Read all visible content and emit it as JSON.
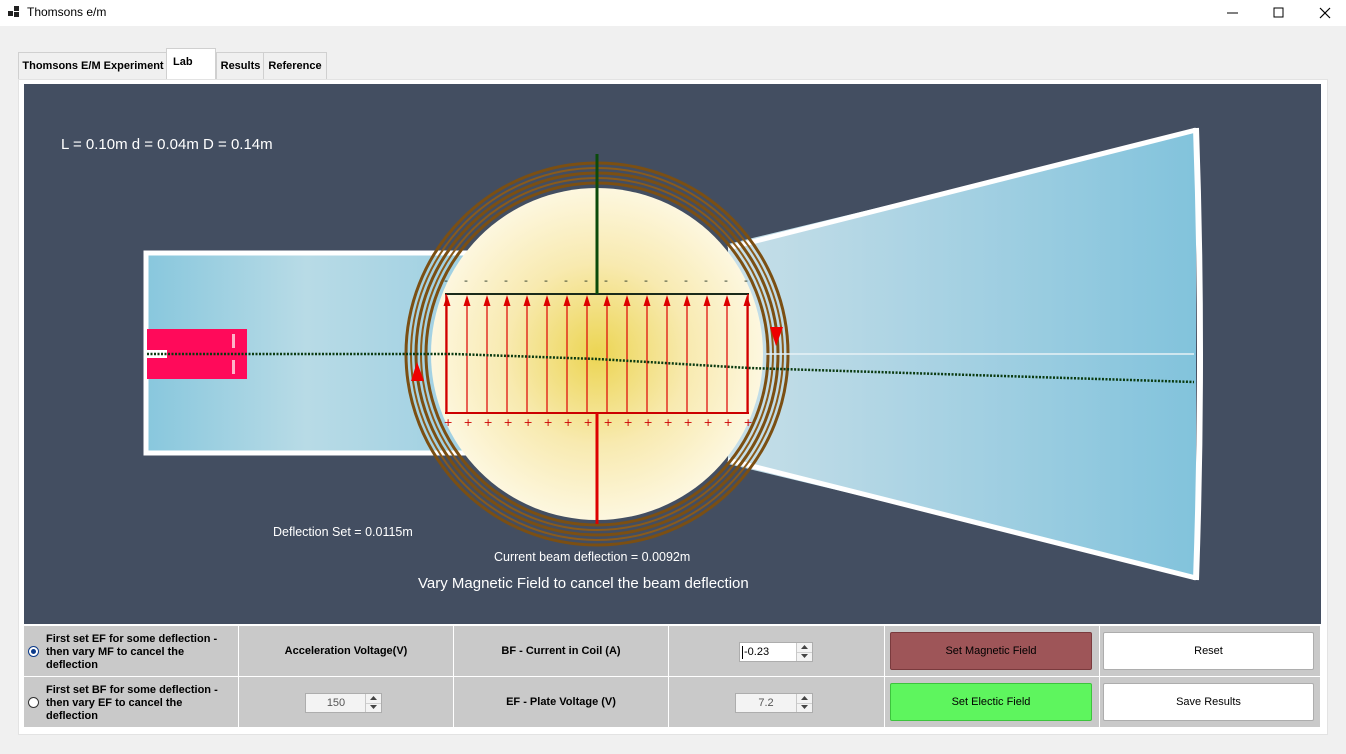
{
  "window": {
    "title": "Thomsons e/m"
  },
  "tabs": [
    {
      "label": "Thomsons E/M Experiment",
      "active": false
    },
    {
      "label": "Lab",
      "active": true
    },
    {
      "label": "Results",
      "active": false
    },
    {
      "label": "Reference",
      "active": false
    }
  ],
  "canvas": {
    "params_label": "L = 0.10m    d = 0.04m   D = 0.14m",
    "deflection_set": "Deflection Set = 0.0115m",
    "current_deflection": "Current beam deflection = 0.0092m",
    "instruction": "Vary Magnetic Field to cancel the beam deflection",
    "top_plate_sign": "-",
    "bottom_plate_sign": "+",
    "colors": {
      "background": "#434e61",
      "tube": "#8fc8dd",
      "gun": "#ff0a5a",
      "coil": "#8a5a1a",
      "field_line": "#dd0000",
      "beam": "#0a3a10"
    }
  },
  "controls": {
    "mode_options": [
      {
        "label": "First set EF  for some  deflection - then vary MF to cancel the deflection",
        "checked": true
      },
      {
        "label": "First set BF for some deflection - then vary EF to cancel the deflection",
        "checked": false
      }
    ],
    "acceleration_voltage": {
      "label": "Acceleration Voltage(V)",
      "value": "150"
    },
    "bf_current": {
      "label": "BF - Current in Coil (A)",
      "value": "-0.23"
    },
    "ef_voltage": {
      "label": "EF - Plate Voltage (V)",
      "value": "7.2"
    },
    "buttons": {
      "set_magnetic": {
        "label": "Set Magnetic Field",
        "color": "#9e5558"
      },
      "set_electric": {
        "label": "Set Electic Field",
        "color": "#5ef55e"
      },
      "reset": {
        "label": "Reset"
      },
      "save": {
        "label": "Save Results"
      }
    }
  }
}
